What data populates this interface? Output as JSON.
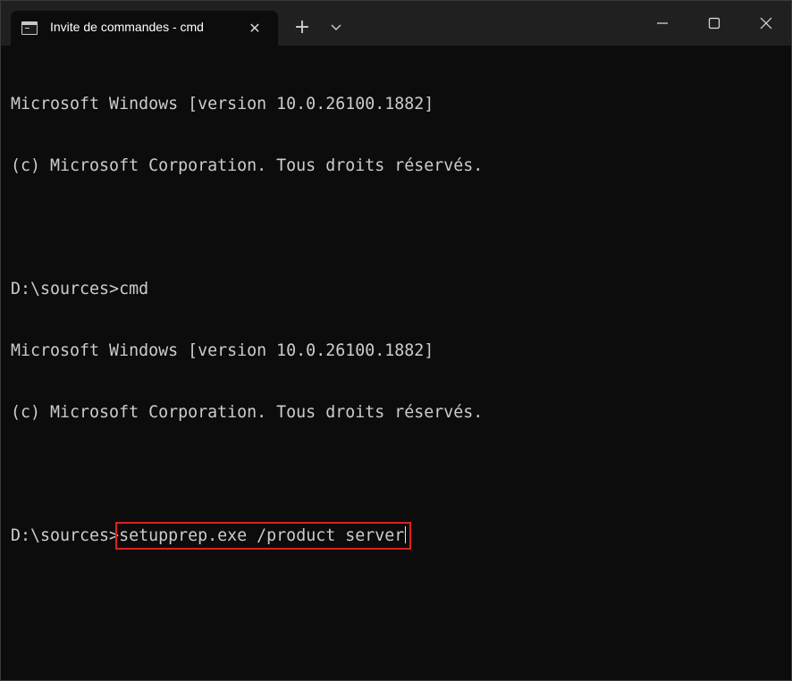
{
  "window": {
    "tab_title": "Invite de commandes - cmd",
    "tab_icon": "console-icon",
    "close_tab_symbol": "✕",
    "new_tab_symbol": "+",
    "dropdown_icon": "chevron-down-icon",
    "controls": [
      "minimize-icon",
      "maximize-icon",
      "close-icon"
    ]
  },
  "terminal": {
    "lines": [
      "Microsoft Windows [version 10.0.26100.1882]",
      "(c) Microsoft Corporation. Tous droits réservés.",
      "",
      "D:\\sources>cmd",
      "Microsoft Windows [version 10.0.26100.1882]",
      "(c) Microsoft Corporation. Tous droits réservés.",
      ""
    ],
    "prompt": "D:\\sources>",
    "current_command": "setupprep.exe /product server",
    "highlight_color": "#e02020",
    "text_color": "#cccccc",
    "background_color": "#0c0c0c"
  }
}
